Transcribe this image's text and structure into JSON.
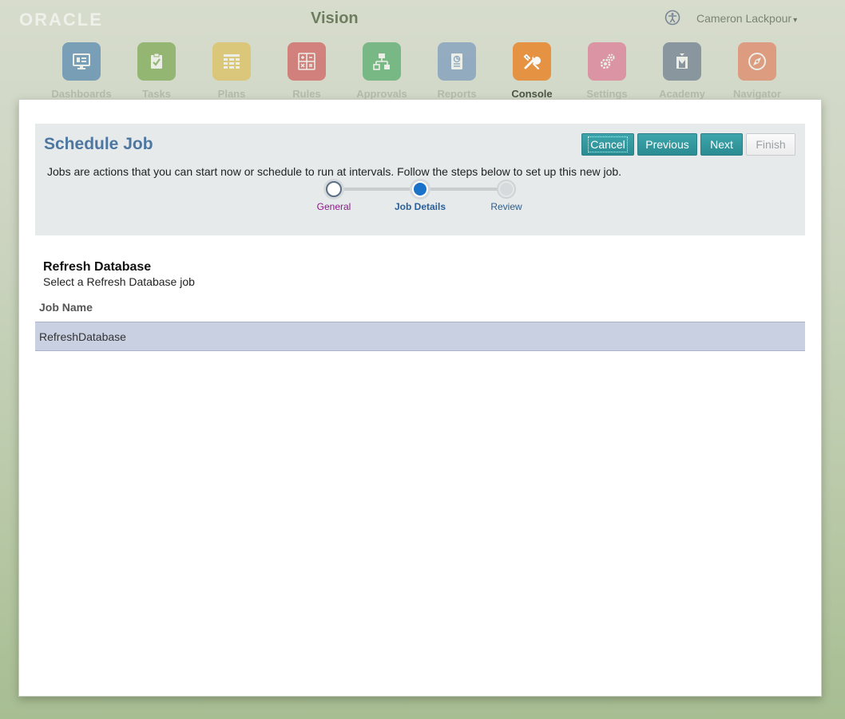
{
  "header": {
    "logo": "ORACLE",
    "app_title": "Vision",
    "user_name": "Cameron Lackpour",
    "user_caret": "▾"
  },
  "nav": [
    {
      "label": "Dashboards",
      "icon": "monitor-icon",
      "color": "#2e6fa8"
    },
    {
      "label": "Tasks",
      "icon": "clipboard-check-icon",
      "color": "#5f9a2c"
    },
    {
      "label": "Plans",
      "icon": "grid-icon",
      "color": "#e0b83a"
    },
    {
      "label": "Rules",
      "icon": "calculator-icon",
      "color": "#d0393d"
    },
    {
      "label": "Approvals",
      "icon": "hierarchy-icon",
      "color": "#2e9e4e"
    },
    {
      "label": "Reports",
      "icon": "report-icon",
      "color": "#5f86b8"
    },
    {
      "label": "Console",
      "icon": "tools-icon",
      "color": "#e8862c"
    },
    {
      "label": "Settings",
      "icon": "gears-icon",
      "color": "#e05c86"
    },
    {
      "label": "Academy",
      "icon": "academy-icon",
      "color": "#4c5f7c"
    },
    {
      "label": "Navigator",
      "icon": "compass-icon",
      "color": "#e56a45"
    }
  ],
  "dialog": {
    "title": "Schedule Job",
    "description": "Jobs are actions that you can start now or schedule to run at intervals. Follow the steps below to set up this new job.",
    "buttons": {
      "cancel": "Cancel",
      "previous": "Previous",
      "next": "Next",
      "finish": "Finish"
    },
    "steps": [
      {
        "label": "General",
        "state": "visited"
      },
      {
        "label": "Job Details",
        "state": "current"
      },
      {
        "label": "Review",
        "state": "unvisited"
      }
    ],
    "section_title": "Refresh Database",
    "section_subtitle": "Select a Refresh Database job",
    "table": {
      "columns": [
        "Job Name"
      ],
      "rows": [
        [
          "RefreshDatabase"
        ]
      ]
    }
  }
}
